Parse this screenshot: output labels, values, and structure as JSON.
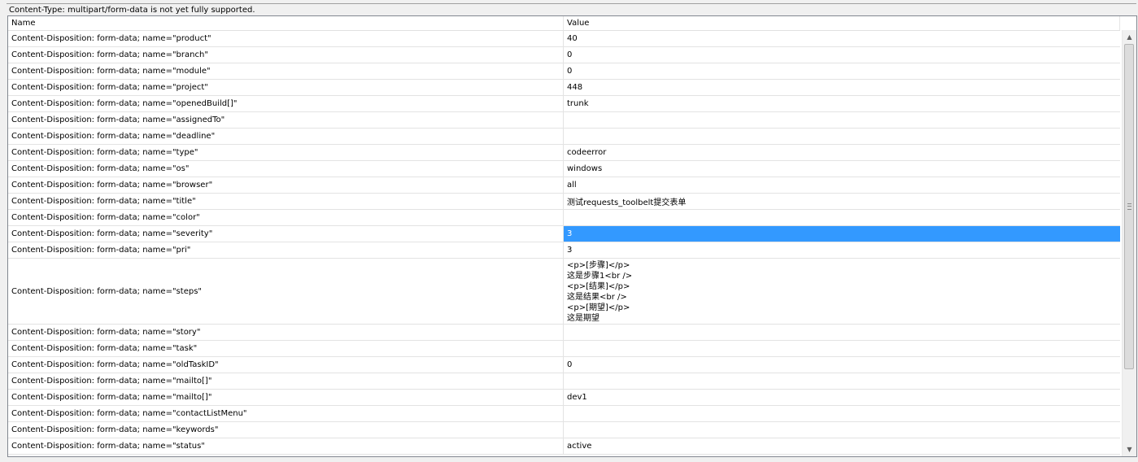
{
  "notice": "Content-Type: multipart/form-data is not yet fully supported.",
  "columns": {
    "name": "Name",
    "value": "Value"
  },
  "rows": [
    {
      "name": "Content-Disposition: form-data; name=\"product\"",
      "value": "40"
    },
    {
      "name": "Content-Disposition: form-data; name=\"branch\"",
      "value": "0"
    },
    {
      "name": "Content-Disposition: form-data; name=\"module\"",
      "value": "0"
    },
    {
      "name": "Content-Disposition: form-data; name=\"project\"",
      "value": "448"
    },
    {
      "name": "Content-Disposition: form-data; name=\"openedBuild[]\"",
      "value": "trunk"
    },
    {
      "name": "Content-Disposition: form-data; name=\"assignedTo\"",
      "value": ""
    },
    {
      "name": "Content-Disposition: form-data; name=\"deadline\"",
      "value": ""
    },
    {
      "name": "Content-Disposition: form-data; name=\"type\"",
      "value": "codeerror"
    },
    {
      "name": "Content-Disposition: form-data; name=\"os\"",
      "value": "windows"
    },
    {
      "name": "Content-Disposition: form-data; name=\"browser\"",
      "value": "all"
    },
    {
      "name": "Content-Disposition: form-data; name=\"title\"",
      "value": "测试requests_toolbelt提交表单"
    },
    {
      "name": "Content-Disposition: form-data; name=\"color\"",
      "value": ""
    },
    {
      "name": "Content-Disposition: form-data; name=\"severity\"",
      "value": "3",
      "selected": true
    },
    {
      "name": "Content-Disposition: form-data; name=\"pri\"",
      "value": "3"
    },
    {
      "name": "Content-Disposition: form-data; name=\"steps\"",
      "value": "<p>[步骤]</p>\n这是步骤1<br />\n<p>[结果]</p>\n这是结果<br />\n<p>[期望]</p>\n这是期望",
      "multiline": true
    },
    {
      "name": "Content-Disposition: form-data; name=\"story\"",
      "value": ""
    },
    {
      "name": "Content-Disposition: form-data; name=\"task\"",
      "value": ""
    },
    {
      "name": "Content-Disposition: form-data; name=\"oldTaskID\"",
      "value": "0"
    },
    {
      "name": "Content-Disposition: form-data; name=\"mailto[]\"",
      "value": ""
    },
    {
      "name": "Content-Disposition: form-data; name=\"mailto[]\"",
      "value": "dev1"
    },
    {
      "name": "Content-Disposition: form-data; name=\"contactListMenu\"",
      "value": ""
    },
    {
      "name": "Content-Disposition: form-data; name=\"keywords\"",
      "value": ""
    },
    {
      "name": "Content-Disposition: form-data; name=\"status\"",
      "value": "active"
    }
  ],
  "selection_color": "#3399ff",
  "icons": {
    "scroll_up": "scroll-up-arrow-icon",
    "scroll_down": "scroll-down-arrow-icon",
    "grip": "scrollbar-grip-icon"
  }
}
